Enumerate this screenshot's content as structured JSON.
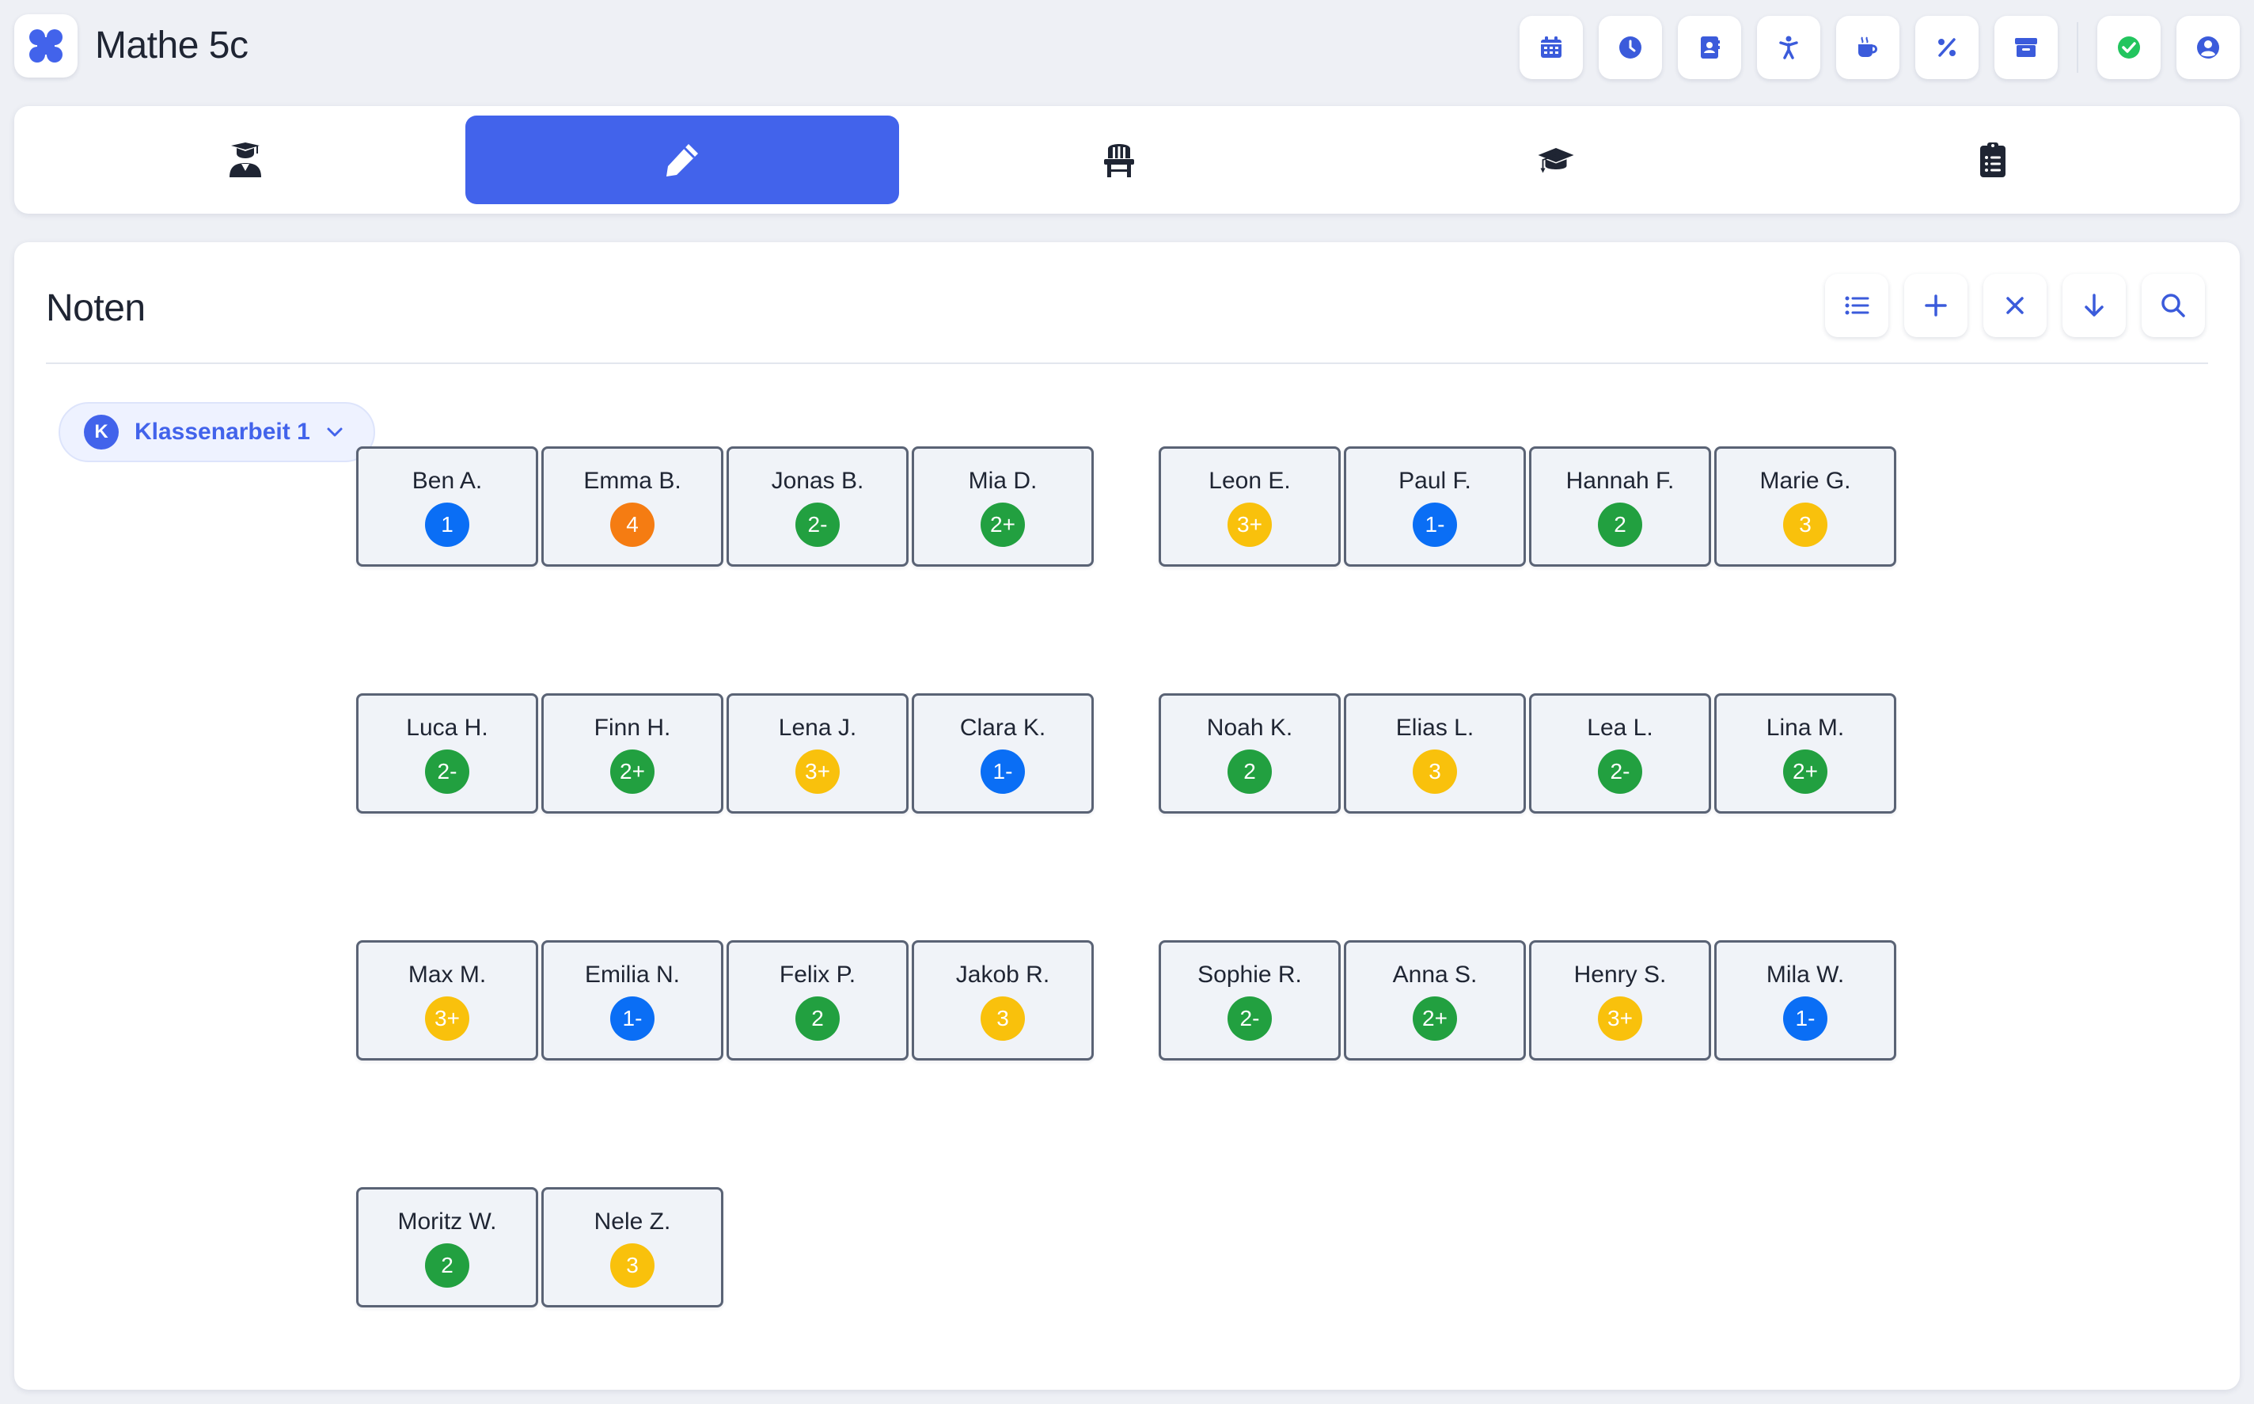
{
  "app": {
    "title": "Mathe 5c",
    "logo": "apps-icon"
  },
  "header_buttons": [
    {
      "id": "calendar",
      "icon": "calendar-icon"
    },
    {
      "id": "clock",
      "icon": "clock-icon"
    },
    {
      "id": "contacts",
      "icon": "contact-book-icon"
    },
    {
      "id": "person",
      "icon": "accessibility-icon"
    },
    {
      "id": "coffee",
      "icon": "coffee-icon"
    },
    {
      "id": "percent",
      "icon": "percent-icon"
    },
    {
      "id": "archive",
      "icon": "archive-icon"
    },
    {
      "id": "status",
      "icon": "check-circle-icon",
      "color": "#22c55e"
    },
    {
      "id": "account",
      "icon": "user-circle-icon"
    }
  ],
  "tabs": [
    {
      "id": "students",
      "icon": "student-icon",
      "active": false
    },
    {
      "id": "grades",
      "icon": "pencil-icon",
      "active": true
    },
    {
      "id": "seating",
      "icon": "chair-icon",
      "active": false
    },
    {
      "id": "exams",
      "icon": "graduation-cap-icon",
      "active": false
    },
    {
      "id": "tasks",
      "icon": "clipboard-list-icon",
      "active": false
    }
  ],
  "section": {
    "title": "Noten"
  },
  "toolbar": [
    {
      "id": "list",
      "icon": "list-icon"
    },
    {
      "id": "add",
      "icon": "plus-icon"
    },
    {
      "id": "clear",
      "icon": "close-icon"
    },
    {
      "id": "sort",
      "icon": "arrow-down-icon"
    },
    {
      "id": "search",
      "icon": "search-icon"
    }
  ],
  "exam": {
    "badge": "K",
    "label": "Klassenarbeit 1"
  },
  "grade_colors": {
    "blue": "#0a6ef5",
    "green": "#22a040",
    "yellow": "#f9c10c",
    "orange": "#f57c12",
    "accent": "#4263eb"
  },
  "students": [
    {
      "name": "Ben A.",
      "grade": "1",
      "color": "blue"
    },
    {
      "name": "Emma B.",
      "grade": "4",
      "color": "orange"
    },
    {
      "name": "Jonas B.",
      "grade": "2-",
      "color": "green"
    },
    {
      "name": "Mia D.",
      "grade": "2+",
      "color": "green"
    },
    {
      "name": "Leon E.",
      "grade": "3+",
      "color": "yellow"
    },
    {
      "name": "Paul F.",
      "grade": "1-",
      "color": "blue"
    },
    {
      "name": "Hannah F.",
      "grade": "2",
      "color": "green"
    },
    {
      "name": "Marie G.",
      "grade": "3",
      "color": "yellow"
    },
    {
      "name": "Luca H.",
      "grade": "2-",
      "color": "green"
    },
    {
      "name": "Finn H.",
      "grade": "2+",
      "color": "green"
    },
    {
      "name": "Lena J.",
      "grade": "3+",
      "color": "yellow"
    },
    {
      "name": "Clara K.",
      "grade": "1-",
      "color": "blue"
    },
    {
      "name": "Noah K.",
      "grade": "2",
      "color": "green"
    },
    {
      "name": "Elias L.",
      "grade": "3",
      "color": "yellow"
    },
    {
      "name": "Lea L.",
      "grade": "2-",
      "color": "green"
    },
    {
      "name": "Lina M.",
      "grade": "2+",
      "color": "green"
    },
    {
      "name": "Max M.",
      "grade": "3+",
      "color": "yellow"
    },
    {
      "name": "Emilia N.",
      "grade": "1-",
      "color": "blue"
    },
    {
      "name": "Felix P.",
      "grade": "2",
      "color": "green"
    },
    {
      "name": "Jakob R.",
      "grade": "3",
      "color": "yellow"
    },
    {
      "name": "Sophie R.",
      "grade": "2-",
      "color": "green"
    },
    {
      "name": "Anna S.",
      "grade": "2+",
      "color": "green"
    },
    {
      "name": "Henry S.",
      "grade": "3+",
      "color": "yellow"
    },
    {
      "name": "Mila W.",
      "grade": "1-",
      "color": "blue"
    },
    {
      "name": "Moritz W.",
      "grade": "2",
      "color": "green"
    },
    {
      "name": "Nele Z.",
      "grade": "3",
      "color": "yellow"
    }
  ]
}
